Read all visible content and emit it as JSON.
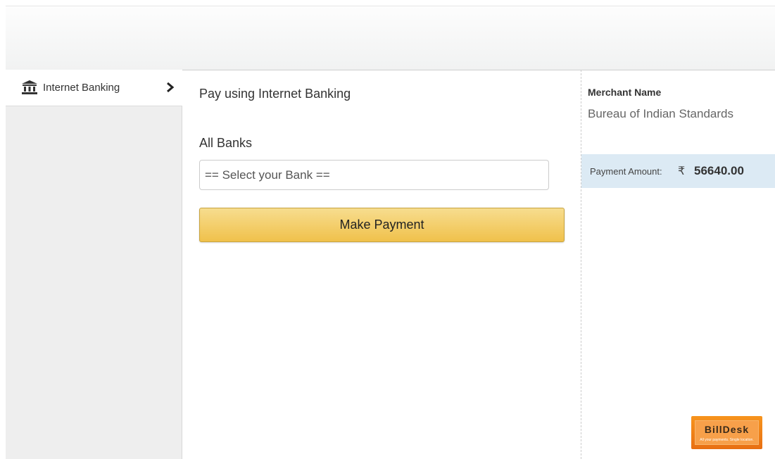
{
  "sidebar": {
    "items": [
      {
        "label": "Internet Banking",
        "icon": "bank-icon",
        "active": true
      }
    ]
  },
  "main": {
    "title": "Pay using Internet Banking",
    "banks_label": "All Banks",
    "bank_select": {
      "selected": "== Select your Bank =="
    },
    "pay_button_label": "Make Payment"
  },
  "summary": {
    "merchant_label": "Merchant Name",
    "merchant_name": "Bureau of Indian Standards",
    "amount_label": "Payment Amount:",
    "currency_symbol": "₹",
    "amount": "56640.00"
  },
  "footer": {
    "logo_text": "BillDesk",
    "logo_tagline": "All your payments. Single location."
  },
  "colors": {
    "button": "#f0c14b",
    "amount_band": "#dceaf4",
    "logo": "#f7941d"
  }
}
